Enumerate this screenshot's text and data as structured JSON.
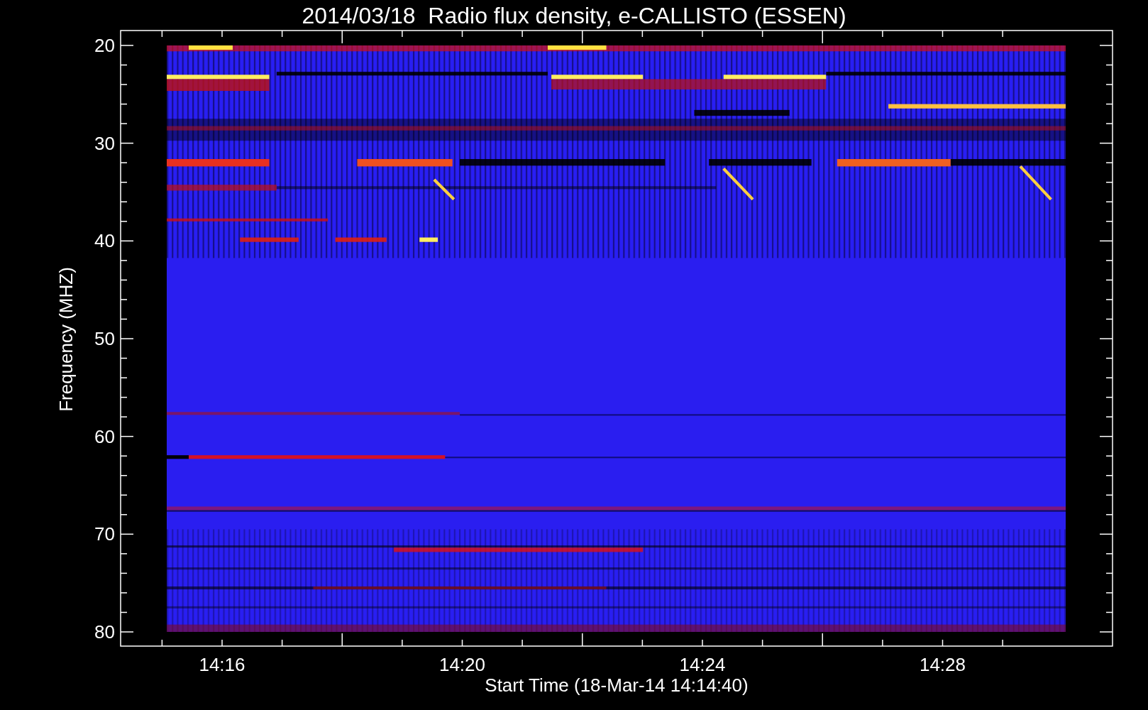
{
  "plot": {
    "title": "2014/03/18  Radio flux density, e-CALLISTO (ESSEN)",
    "y_axis": {
      "label": "Frequency (MHZ)",
      "ticks": [
        "20",
        "30",
        "40",
        "50",
        "60",
        "70",
        "80"
      ]
    },
    "x_axis": {
      "label": "Start Time (18-Mar-14 14:14:40)",
      "ticks": [
        "14:16",
        "14:20",
        "14:24",
        "14:28"
      ]
    }
  }
}
